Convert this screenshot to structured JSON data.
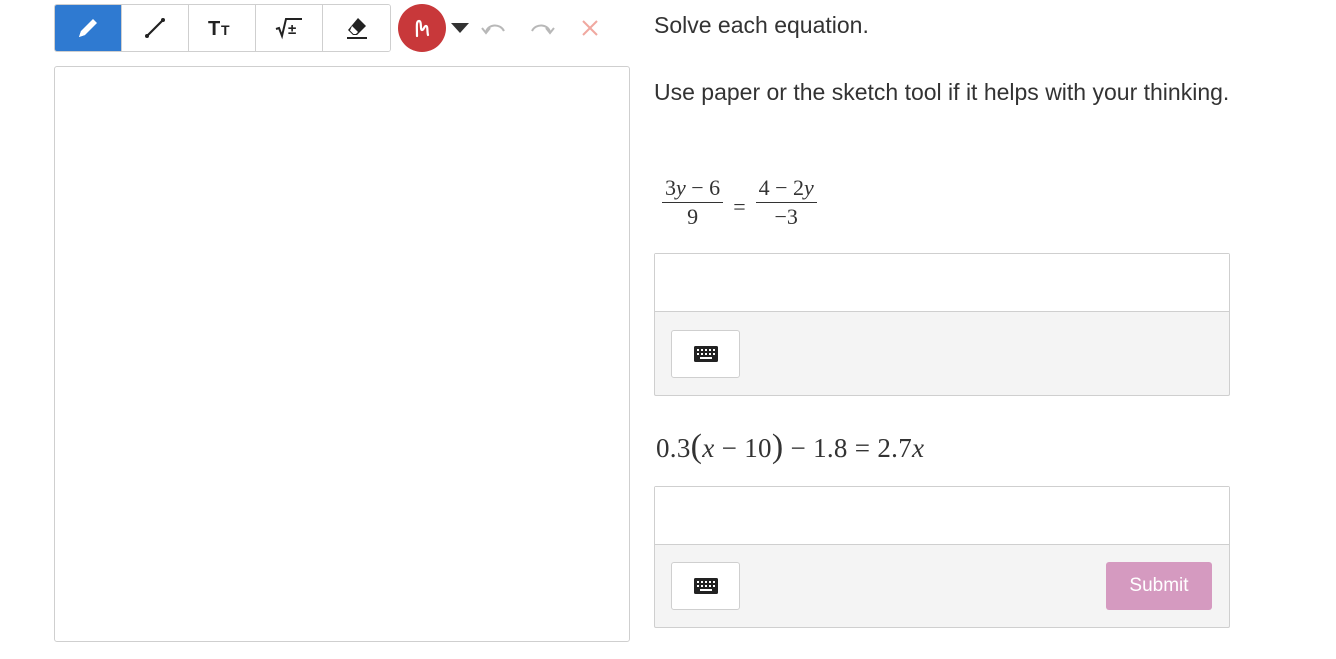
{
  "toolbar": {
    "tools": [
      {
        "name": "pencil",
        "icon": "pencil-icon",
        "active": true
      },
      {
        "name": "line",
        "icon": "line-icon",
        "active": false
      },
      {
        "name": "text",
        "icon": "text-size-icon",
        "label": "Tт",
        "active": false
      },
      {
        "name": "math",
        "icon": "math-sqrt-icon",
        "label": "√±",
        "active": false
      },
      {
        "name": "eraser",
        "icon": "eraser-icon",
        "active": false
      }
    ],
    "active_color": "#c8383a",
    "accent_color": "#2f7ad1",
    "undo_icon": "undo-icon",
    "redo_icon": "redo-icon",
    "clear_icon": "close-icon"
  },
  "content": {
    "instruction": "Solve each equation.",
    "instruction2": "Use paper or the sketch tool if it helps with your thinking.",
    "problem1": {
      "left_num": "3y − 6",
      "left_den": "9",
      "equals": "=",
      "right_num": "4 − 2y",
      "right_den": "−3"
    },
    "problem2": {
      "text_a": "0.3",
      "lparen": "(",
      "text_b": "x − 10",
      "rparen": ")",
      "text_c": " − 1.8 = 2.7x"
    },
    "submit_label": "Submit",
    "submit_color": "#d59ac0"
  }
}
